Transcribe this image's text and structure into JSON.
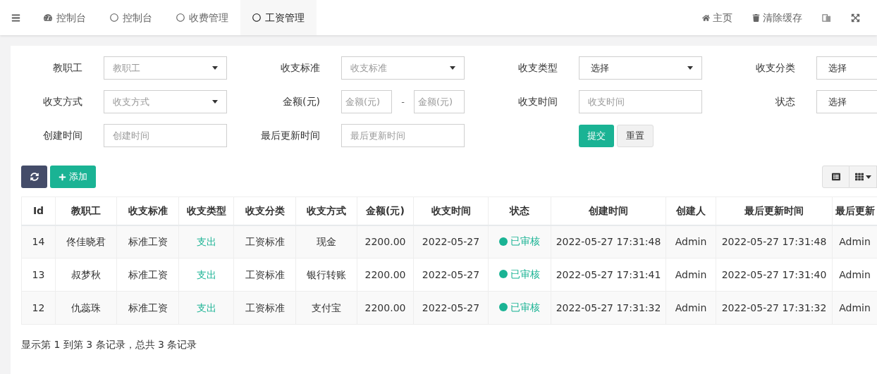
{
  "nav_tabs": [
    {
      "label": "控制台",
      "selected": false
    },
    {
      "label": "控制台",
      "selected": false
    },
    {
      "label": "收费管理",
      "selected": false
    },
    {
      "label": "工资管理",
      "selected": true
    }
  ],
  "top_actions": [
    {
      "label": "主页"
    },
    {
      "label": "清除缓存"
    }
  ],
  "filter_rows": [
    [
      {
        "label": "教职工",
        "kind": "select",
        "placeholder": "教职工"
      },
      {
        "label": "收支标准",
        "kind": "select",
        "placeholder": "收支标准"
      },
      {
        "label": "收支类型",
        "kind": "select",
        "value": "选择"
      },
      {
        "label": "收支分类",
        "kind": "select",
        "value": "选择"
      }
    ],
    [
      {
        "label": "收支方式",
        "kind": "select",
        "placeholder": "收支方式"
      },
      {
        "label": "金额(元)",
        "kind": "range",
        "placeholder": "金额(元)",
        "separator": "-",
        "placeholder_to": "金额(元)"
      },
      {
        "label": "收支时间",
        "kind": "input",
        "placeholder": "收支时间"
      },
      {
        "label": "状态",
        "kind": "select",
        "value": "选择"
      }
    ],
    [
      {
        "label": "创建时间",
        "kind": "input",
        "placeholder": "创建时间"
      },
      {
        "label": "最后更新时间",
        "kind": "input",
        "placeholder": "最后更新时间"
      },
      {
        "kind": "buttons",
        "submit": "提交",
        "reset": "重置"
      }
    ]
  ],
  "toolbar": {
    "add": "添加"
  },
  "table": {
    "columns": [
      "Id",
      "教职工",
      "收支标准",
      "收支类型",
      "收支分类",
      "收支方式",
      "金额(元)",
      "收支时间",
      "状态",
      "创建时间",
      "创建人",
      "最后更新时间",
      "最后更新"
    ],
    "rows": [
      {
        "cells": [
          "14",
          "佟佳晓君",
          "标准工资",
          "支出",
          "工资标准",
          "现金",
          "2200.00",
          "2022-05-27",
          "已审核",
          "2022-05-27 17:31:48",
          "Admin",
          "2022-05-27 17:31:48",
          "Admin"
        ]
      },
      {
        "cells": [
          "13",
          "叔梦秋",
          "标准工资",
          "支出",
          "工资标准",
          "银行转账",
          "2200.00",
          "2022-05-27",
          "已审核",
          "2022-05-27 17:31:41",
          "Admin",
          "2022-05-27 17:31:40",
          "Admin"
        ]
      },
      {
        "cells": [
          "12",
          "仇蕊珠",
          "标准工资",
          "支出",
          "工资标准",
          "支付宝",
          "2200.00",
          "2022-05-27",
          "已审核",
          "2022-05-27 17:31:32",
          "Admin",
          "2022-05-27 17:31:32",
          "Admin"
        ]
      }
    ]
  },
  "pagination_info": "显示第 1 到第 3 条记录，总共 3 条记录"
}
